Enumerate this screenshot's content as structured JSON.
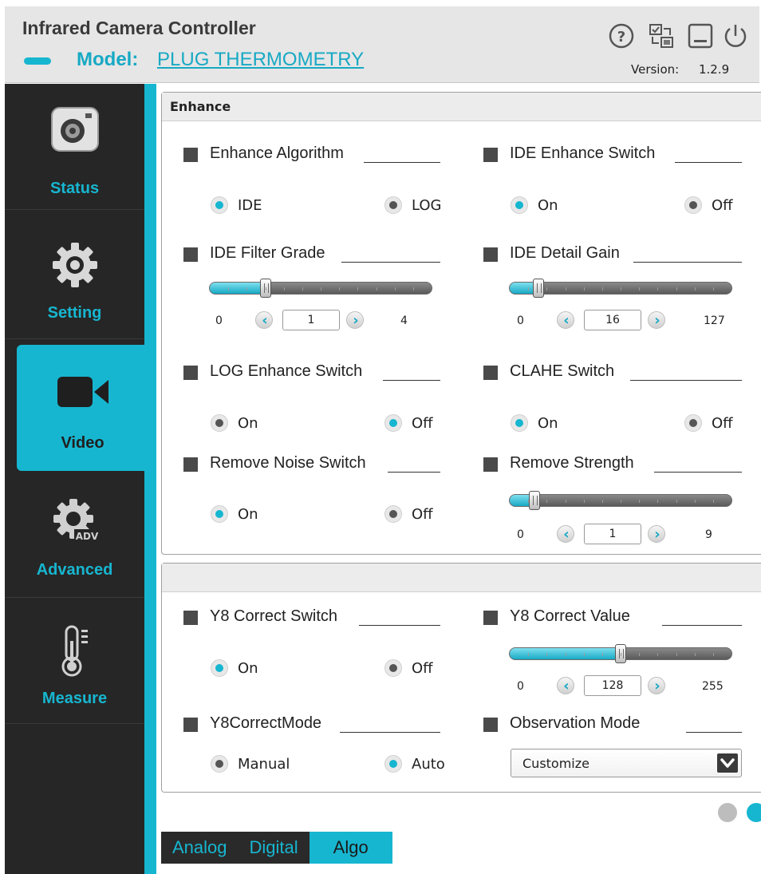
{
  "header": {
    "app_title": "Infrared Camera Controller",
    "model_label": "Model:",
    "model_value": "PLUG THERMOMETRY",
    "version_label": "Version:",
    "version_value": "1.2.9",
    "icons": [
      "help-icon",
      "device-switch-icon",
      "minimize-icon",
      "power-icon"
    ]
  },
  "sidebar": {
    "items": [
      {
        "label": "Status",
        "icon": "camera-icon"
      },
      {
        "label": "Setting",
        "icon": "gear-icon"
      },
      {
        "label": "Video",
        "icon": "video-camera-icon",
        "active": true
      },
      {
        "label": "Advanced",
        "icon": "advanced-gear-icon"
      },
      {
        "label": "Measure",
        "icon": "thermometer-icon"
      }
    ]
  },
  "enhance_panel": {
    "title": "Enhance",
    "enhance_algorithm": {
      "label": "Enhance Algorithm",
      "options": [
        "IDE",
        "LOG"
      ],
      "selected": "IDE"
    },
    "ide_enhance_switch": {
      "label": "IDE Enhance Switch",
      "options": [
        "On",
        "Off"
      ],
      "selected": "On"
    },
    "ide_filter_grade": {
      "label": "IDE Filter  Grade",
      "min": "0",
      "max": "4",
      "value": "1",
      "fraction": 0.25
    },
    "ide_detail_gain": {
      "label": "IDE Detail Gain",
      "min": "0",
      "max": "127",
      "value": "16",
      "fraction": 0.13
    },
    "log_enhance_switch": {
      "label": "LOG Enhance Switch",
      "options": [
        "On",
        "Off"
      ],
      "selected": "Off"
    },
    "clahe_switch": {
      "label": "CLAHE Switch",
      "options": [
        "On",
        "Off"
      ],
      "selected": "On"
    },
    "remove_noise_switch": {
      "label": "Remove Noise Switch",
      "options": [
        "On",
        "Off"
      ],
      "selected": "On"
    },
    "remove_strength": {
      "label": "Remove Strength",
      "min": "0",
      "max": "9",
      "value": "1",
      "fraction": 0.11
    }
  },
  "correct_panel": {
    "y8_correct_switch": {
      "label": "Y8 Correct Switch",
      "options": [
        "On",
        "Off"
      ],
      "selected": "On"
    },
    "y8_correct_value": {
      "label": "Y8 Correct Value",
      "min": "0",
      "max": "255",
      "value": "128",
      "fraction": 0.5
    },
    "y8_correct_mode": {
      "label": "Y8CorrectMode",
      "options": [
        "Manual",
        "Auto"
      ],
      "selected": "Auto"
    },
    "observation_mode": {
      "label": "Observation Mode",
      "value": "Customize"
    }
  },
  "bottom_tabs": [
    {
      "label": "Analog"
    },
    {
      "label": "Digital"
    },
    {
      "label": "Algo",
      "active": true
    }
  ],
  "colors": {
    "accent": "#17b6d0",
    "sidebar_bg": "#262626",
    "header_bg": "#e6e6e6"
  }
}
